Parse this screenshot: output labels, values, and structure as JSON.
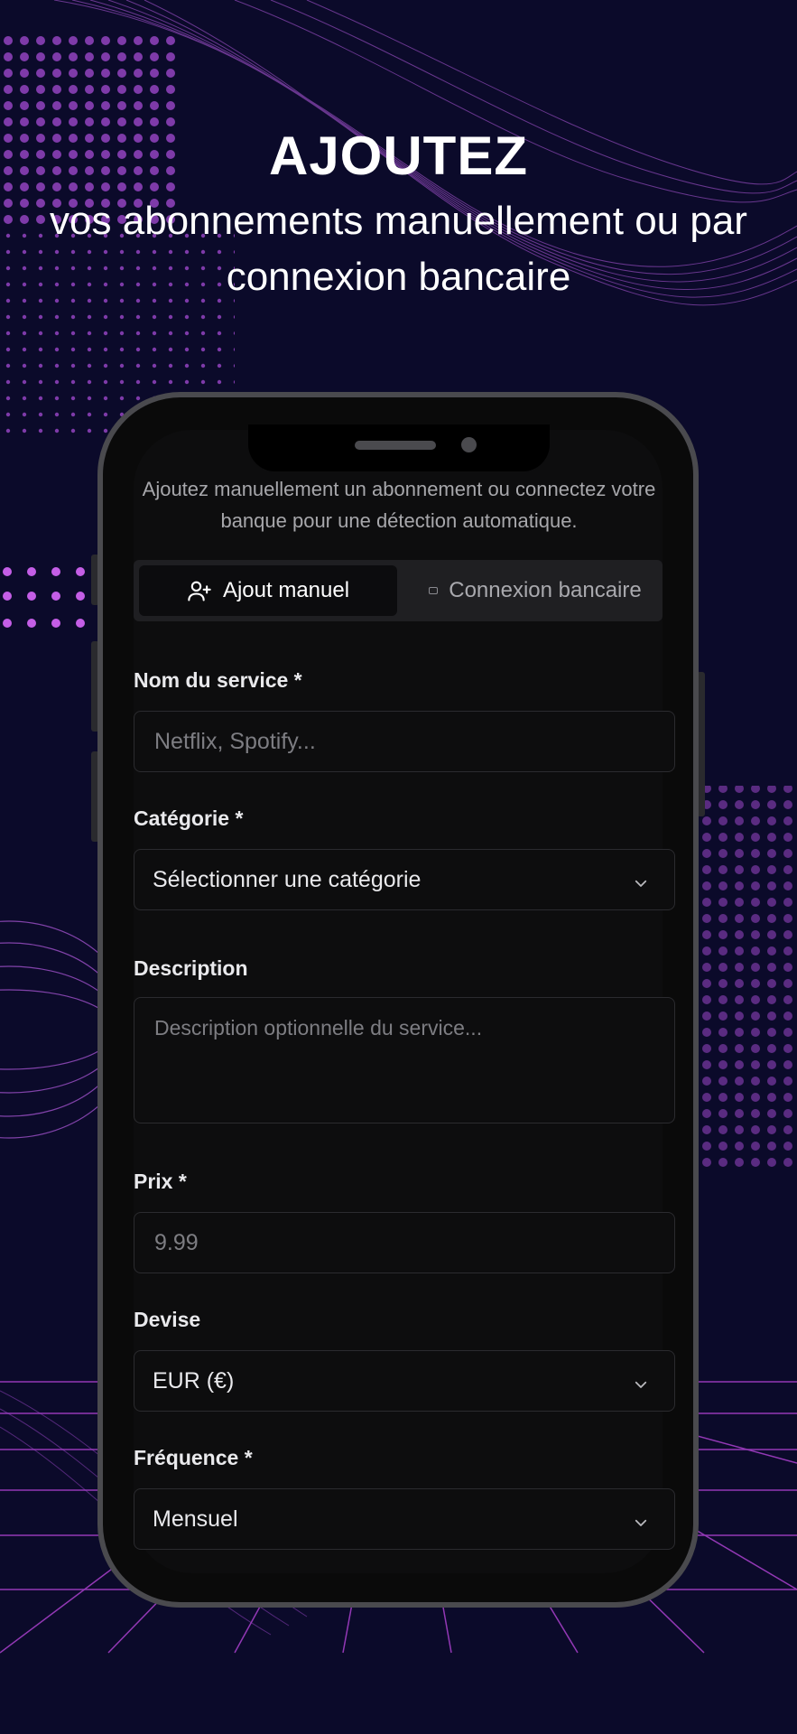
{
  "hero": {
    "title": "AJOUTEZ",
    "subtitle": "vos abonnements manuellement ou par connexion bancaire"
  },
  "app": {
    "intro": "Ajoutez manuellement un abonnement ou connectez votre banque pour une détection automatique.",
    "tabs": [
      {
        "label": "Ajout manuel",
        "icon": "user-plus-icon",
        "active": true
      },
      {
        "label": "Connexion bancaire",
        "icon": "card-icon",
        "active": false
      }
    ],
    "form": {
      "service": {
        "label": "Nom du service *",
        "placeholder": "Netflix, Spotify..."
      },
      "category": {
        "label": "Catégorie *",
        "value": "Sélectionner une catégorie"
      },
      "description": {
        "label": "Description",
        "placeholder": "Description optionnelle du service..."
      },
      "price": {
        "label": "Prix *",
        "placeholder": "9.99"
      },
      "currency": {
        "label": "Devise",
        "value": "EUR (€)"
      },
      "frequency": {
        "label": "Fréquence *",
        "value": "Mensuel"
      }
    }
  },
  "colors": {
    "background": "#0b0a2a",
    "accent_purple": "#c45ee6",
    "screen": "#0d0d0e"
  }
}
